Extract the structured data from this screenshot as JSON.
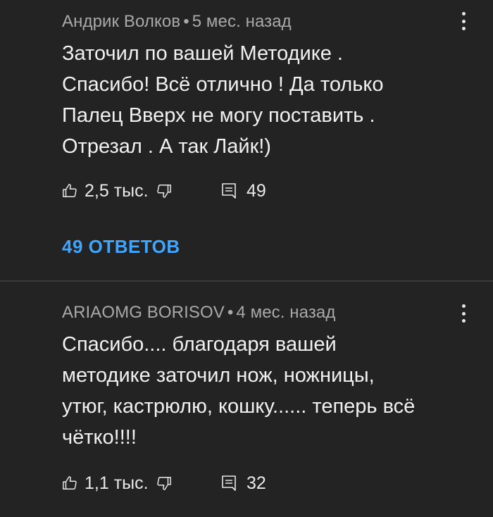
{
  "comments": [
    {
      "author": "Андрик Волков",
      "separator": "•",
      "time": "5 мес. назад",
      "lines": [
        "Заточил по вашей Методике .",
        "Спасибо! Всё отлично ! Да только",
        "Палец Вверх не могу поставить .",
        "Отрезал . А так Лайк!)"
      ],
      "likes": "2,5 тыс.",
      "replies_count": "49",
      "view_replies_label": "49 ОТВЕТОВ"
    },
    {
      "author": "ARIAOMG BORISOV",
      "separator": "•",
      "time": "4 мес. назад",
      "lines": [
        "Спасибо.... благодаря вашей",
        "методике заточил нож, ножницы,",
        "утюг, кастрюлю, кошку...... теперь всё",
        "чётко!!!!"
      ],
      "likes": "1,1 тыс.",
      "replies_count": "32"
    }
  ],
  "icons": {
    "like": "thumb-up-icon",
    "dislike": "thumb-down-icon",
    "reply": "comment-icon",
    "more": "more-vert-icon"
  },
  "colors": {
    "background": "#232323",
    "accent": "#3ea6ff",
    "meta": "#a9a9a9",
    "text": "#f1f1f1"
  }
}
